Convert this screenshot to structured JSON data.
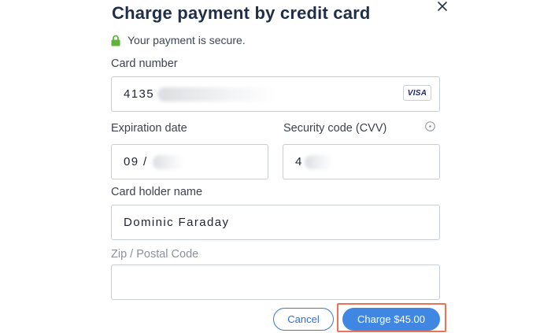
{
  "dialog": {
    "title": "Charge payment by credit card",
    "secure_text": "Your payment is secure.",
    "colors": {
      "accent": "#3f87e3",
      "secure_lock": "#5fb53a",
      "highlight": "#e8735a"
    }
  },
  "form": {
    "card_number": {
      "label": "Card number",
      "value": "4135",
      "card_brand": "VISA"
    },
    "expiration": {
      "label": "Expiration date",
      "value": "09 /"
    },
    "cvv": {
      "label": "Security code (CVV)",
      "value": "4",
      "help_icon": "info-icon"
    },
    "holder_name": {
      "label": "Card holder name",
      "value": "Dominic Faraday"
    },
    "zip": {
      "label": "Zip / Postal Code",
      "value": ""
    }
  },
  "actions": {
    "cancel_label": "Cancel",
    "charge_label": "Charge $45.00"
  }
}
